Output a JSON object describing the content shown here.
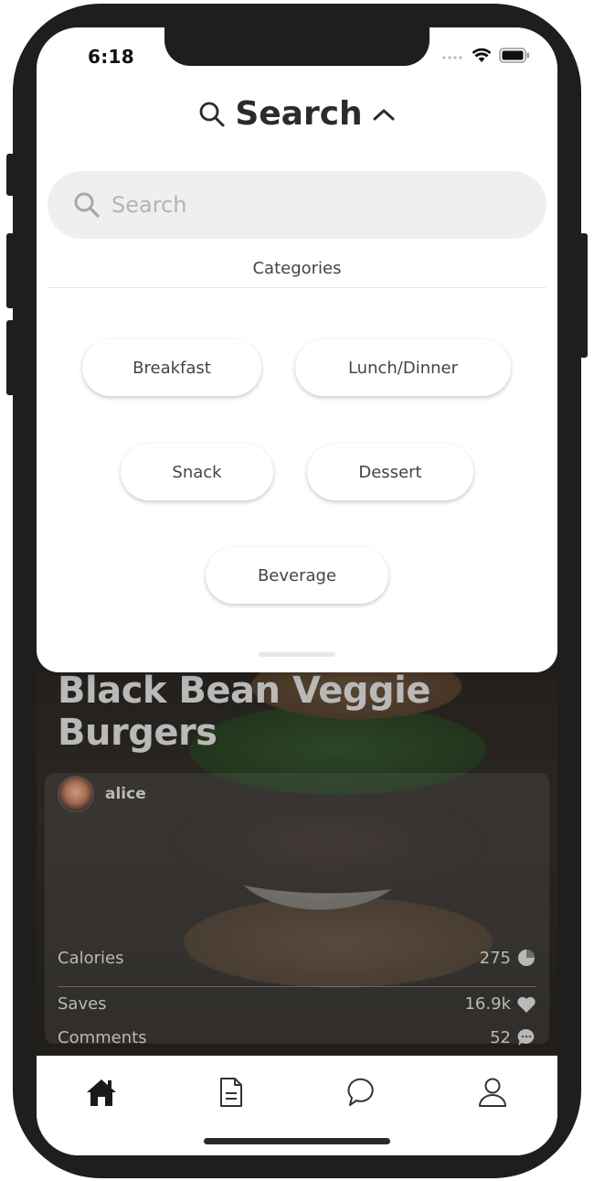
{
  "status_bar": {
    "time": "6:18"
  },
  "search_sheet": {
    "title": "Search",
    "search_placeholder": "Search",
    "categories_label": "Categories",
    "categories": [
      "Breakfast",
      "Lunch/Dinner",
      "Snack",
      "Dessert",
      "Beverage"
    ]
  },
  "recipe_card": {
    "title": "Black Bean Veggie Burgers",
    "author": "alice",
    "stats": [
      {
        "label": "Calories",
        "value": "275",
        "icon": "pie-chart-icon"
      },
      {
        "label": "Saves",
        "value": "16.9k",
        "icon": "heart-icon"
      },
      {
        "label": "Comments",
        "value": "52",
        "icon": "comment-icon"
      }
    ]
  },
  "tab_bar": {
    "tabs": [
      {
        "icon": "home-icon",
        "active": true
      },
      {
        "icon": "document-icon",
        "active": false
      },
      {
        "icon": "chat-icon",
        "active": false
      },
      {
        "icon": "profile-icon",
        "active": false
      }
    ]
  }
}
